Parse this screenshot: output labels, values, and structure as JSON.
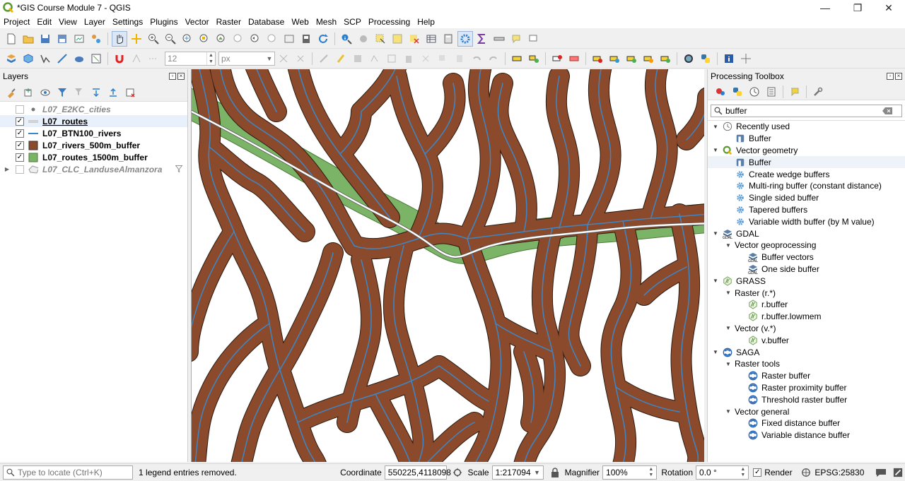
{
  "window": {
    "title": "*GIS Course Module 7 - QGIS"
  },
  "menu": [
    "Project",
    "Edit",
    "View",
    "Layer",
    "Settings",
    "Plugins",
    "Vector",
    "Raster",
    "Database",
    "Web",
    "Mesh",
    "SCP",
    "Processing",
    "Help"
  ],
  "digitize": {
    "size_value": "12",
    "unit_value": "px"
  },
  "layers_panel": {
    "title": "Layers",
    "layers": [
      {
        "name": "L07_E2KC_cities",
        "checked": false,
        "disabled": true,
        "symbol": "point"
      },
      {
        "name": "L07_routes",
        "checked": true,
        "selected": true,
        "symbol": "line-grey"
      },
      {
        "name": "L07_BTN100_rivers",
        "checked": true,
        "symbol": "line-blue"
      },
      {
        "name": "L07_rivers_500m_buffer",
        "checked": true,
        "symbol": "fill-brown"
      },
      {
        "name": "L07_routes_1500m_buffer",
        "checked": true,
        "symbol": "fill-green"
      },
      {
        "name": "L07_CLC_LanduseAlmanzora",
        "checked": false,
        "disabled": true,
        "symbol": "polygon-outline",
        "has_filter": true
      }
    ]
  },
  "toolbox": {
    "title": "Processing Toolbox",
    "search_value": "buffer",
    "tree": [
      {
        "level": 0,
        "expand": "open",
        "icon": "clock-icon",
        "label": "Recently used"
      },
      {
        "level": 1,
        "icon": "buffer-icon",
        "label": "Buffer"
      },
      {
        "level": 0,
        "expand": "open",
        "icon": "qgis-icon",
        "label": "Vector geometry"
      },
      {
        "level": 1,
        "icon": "buffer-icon",
        "label": "Buffer",
        "highlight": true
      },
      {
        "level": 1,
        "icon": "gear-icon",
        "label": "Create wedge buffers"
      },
      {
        "level": 1,
        "icon": "gear-icon",
        "label": "Multi-ring buffer (constant distance)"
      },
      {
        "level": 1,
        "icon": "gear-icon",
        "label": "Single sided buffer"
      },
      {
        "level": 1,
        "icon": "gear-icon",
        "label": "Tapered buffers"
      },
      {
        "level": 1,
        "icon": "gear-icon",
        "label": "Variable width buffer (by M value)"
      },
      {
        "level": 0,
        "expand": "open",
        "icon": "gdal-icon",
        "label": "GDAL"
      },
      {
        "level": 1,
        "expand": "open",
        "icon": "",
        "label": "Vector geoprocessing"
      },
      {
        "level": 2,
        "icon": "gdal-icon",
        "label": "Buffer vectors"
      },
      {
        "level": 2,
        "icon": "gdal-icon",
        "label": "One side buffer"
      },
      {
        "level": 0,
        "expand": "open",
        "icon": "grass-icon",
        "label": "GRASS"
      },
      {
        "level": 1,
        "expand": "open",
        "icon": "",
        "label": "Raster (r.*)"
      },
      {
        "level": 2,
        "icon": "grass-icon",
        "label": "r.buffer"
      },
      {
        "level": 2,
        "icon": "grass-icon",
        "label": "r.buffer.lowmem"
      },
      {
        "level": 1,
        "expand": "open",
        "icon": "",
        "label": "Vector (v.*)"
      },
      {
        "level": 2,
        "icon": "grass-icon",
        "label": "v.buffer"
      },
      {
        "level": 0,
        "expand": "open",
        "icon": "saga-icon",
        "label": "SAGA"
      },
      {
        "level": 1,
        "expand": "open",
        "icon": "",
        "label": "Raster tools"
      },
      {
        "level": 2,
        "icon": "saga-icon",
        "label": "Raster buffer"
      },
      {
        "level": 2,
        "icon": "saga-icon",
        "label": "Raster proximity buffer"
      },
      {
        "level": 2,
        "icon": "saga-icon",
        "label": "Threshold raster buffer"
      },
      {
        "level": 1,
        "expand": "open",
        "icon": "",
        "label": "Vector general"
      },
      {
        "level": 2,
        "icon": "saga-icon",
        "label": "Fixed distance buffer"
      },
      {
        "level": 2,
        "icon": "saga-icon",
        "label": "Variable distance buffer"
      }
    ]
  },
  "status": {
    "locator_placeholder": "Type to locate (Ctrl+K)",
    "message": "1 legend entries removed.",
    "coordinate_label": "Coordinate",
    "coordinate_value": "550225,4118098",
    "scale_label": "Scale",
    "scale_value": "1:217094",
    "magnifier_label": "Magnifier",
    "magnifier_value": "100%",
    "rotation_label": "Rotation",
    "rotation_value": "0.0 °",
    "render_label": "Render",
    "render_checked": true,
    "crs": "EPSG:25830"
  },
  "colors": {
    "river_buffer": "#8b4a2b",
    "river_line": "#3d87c7",
    "route_buffer": "#7cb467",
    "route_line": "#ffffff"
  }
}
